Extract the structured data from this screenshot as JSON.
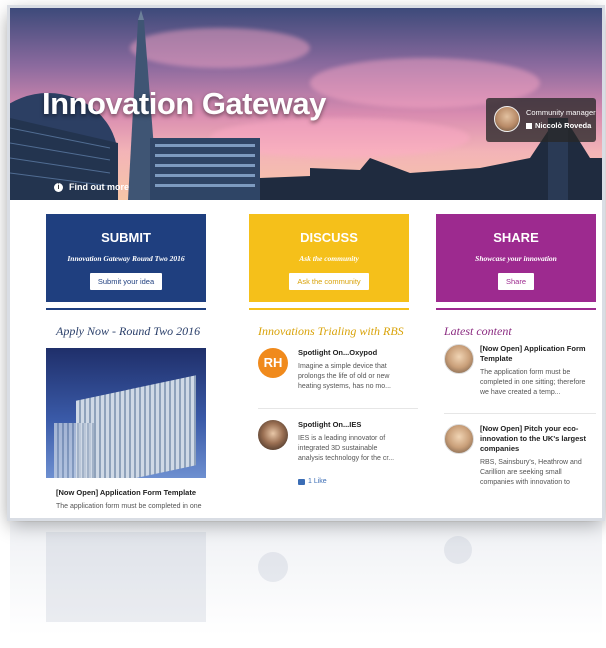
{
  "hero": {
    "title": "Innovation Gateway",
    "find_out_more": "Find out more",
    "manager_role": "Community manager",
    "manager_name": "Niccolò Roveda"
  },
  "cards": [
    {
      "title": "SUBMIT",
      "subtitle": "Innovation Gateway Round Two 2016",
      "button": "Submit your idea",
      "color": "#1f3f7f"
    },
    {
      "title": "DISCUSS",
      "subtitle": "Ask the community",
      "button": "Ask the community",
      "color": "#f5c01a"
    },
    {
      "title": "SHARE",
      "subtitle": "Showcase your innovation",
      "button": "Share",
      "color": "#9d2a8f"
    }
  ],
  "columns": {
    "left": {
      "heading": "Apply Now - Round Two 2016",
      "item_title": "[Now Open] Application Form Template",
      "item_text": "The application form must be completed in one"
    },
    "middle": {
      "heading": "Innovations Trialing with RBS",
      "items": [
        {
          "avatar_initials": "RH",
          "title": "Spotlight On...Oxypod",
          "text": "Imagine a simple device that prolongs the life of old or new heating systems, has no mo..."
        },
        {
          "title": "Spotlight On...IES",
          "text": "IES is a leading innovator of integrated 3D sustainable analysis technology for the cr...",
          "likes": "1 Like"
        }
      ]
    },
    "right": {
      "heading": "Latest content",
      "items": [
        {
          "title": "[Now Open] Application Form Template",
          "text": "The application form must be completed in one sitting; therefore we have created a temp..."
        },
        {
          "title": "[Now Open] Pitch your eco-innovation to the UK's largest companies",
          "text": "RBS, Sainsbury's, Heathrow and Carillion are seeking small companies with innovation to"
        }
      ]
    }
  },
  "colors": {
    "submit": "#1f3f7f",
    "discuss": "#f5c01a",
    "share": "#9d2a8f",
    "discuss_text": "#d9a30a",
    "share_text": "#8a2a80",
    "left_heading": "#2a3f6a"
  }
}
